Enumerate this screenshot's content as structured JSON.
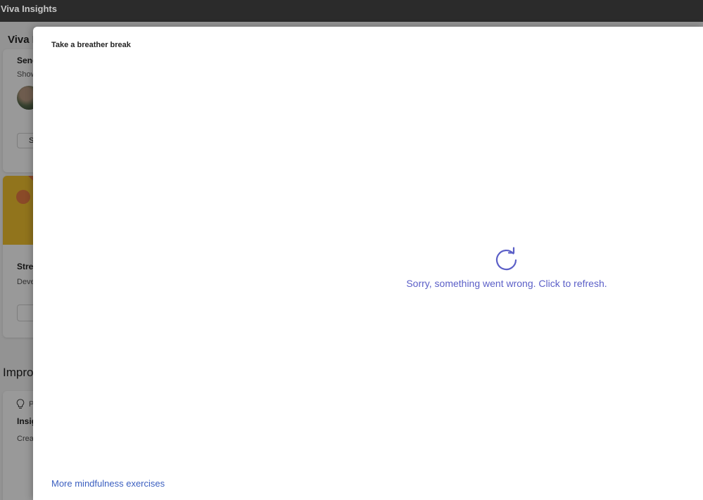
{
  "window": {
    "title": "Viva Insights"
  },
  "background": {
    "heading": "Viva I",
    "card1": {
      "title": "Send",
      "subtitle": "Show",
      "button_label": "S"
    },
    "card2": {
      "title": "Stre",
      "subtitle": "Deve"
    },
    "section_heading": "Impro",
    "card3": {
      "label": "P",
      "title": "Insig",
      "subtitle": "Crea"
    }
  },
  "dialog": {
    "title": "Take a breather break",
    "error_message": "Sorry, something went wrong. Click to refresh.",
    "footer_link": "More mindfulness exercises"
  },
  "colors": {
    "accent": "#5b5fc7",
    "link": "#3b5fc0",
    "titlebar": "#2b2b2b"
  },
  "icons": {
    "refresh": "refresh-icon",
    "bulb": "lightbulb-icon"
  }
}
